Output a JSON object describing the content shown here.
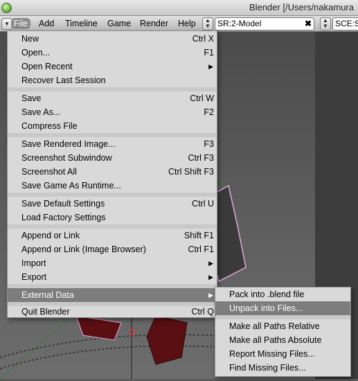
{
  "window": {
    "title": "Blender [/Users/nakamura"
  },
  "menubar": {
    "items": [
      "File",
      "Add",
      "Timeline",
      "Game",
      "Render",
      "Help"
    ],
    "screen_field": "SR:2-Model",
    "screen_close": "✖",
    "scene_field": "SCE:S"
  },
  "file_menu": {
    "items": [
      {
        "label": "New",
        "shortcut": "Ctrl X"
      },
      {
        "label": "Open...",
        "shortcut": "F1"
      },
      {
        "label": "Open Recent",
        "arrow": "▶"
      },
      {
        "label": "Recover Last Session",
        "shortcut": ""
      },
      {
        "label": "Save",
        "shortcut": "Ctrl W"
      },
      {
        "label": "Save As...",
        "shortcut": "F2"
      },
      {
        "label": "Compress File",
        "shortcut": ""
      },
      {
        "label": "Save Rendered Image...",
        "shortcut": "F3"
      },
      {
        "label": "Screenshot Subwindow",
        "shortcut": "Ctrl F3"
      },
      {
        "label": "Screenshot All",
        "shortcut": "Ctrl Shift F3"
      },
      {
        "label": "Save Game As Runtime...",
        "shortcut": ""
      },
      {
        "label": "Save Default Settings",
        "shortcut": "Ctrl U"
      },
      {
        "label": "Load Factory Settings",
        "shortcut": ""
      },
      {
        "label": "Append or Link",
        "shortcut": "Shift F1"
      },
      {
        "label": "Append or Link (Image Browser)",
        "shortcut": "Ctrl F1"
      },
      {
        "label": "Import",
        "arrow": "▶"
      },
      {
        "label": "Export",
        "arrow": "▶"
      },
      {
        "label": "External Data",
        "arrow": "▶"
      },
      {
        "label": "Quit Blender",
        "shortcut": "Ctrl Q"
      }
    ]
  },
  "external_data_menu": {
    "items": [
      {
        "label": "Pack into .blend file"
      },
      {
        "label": "Unpack into Files..."
      },
      {
        "label": "Make all Paths Relative"
      },
      {
        "label": "Make all Paths Absolute"
      },
      {
        "label": "Report Missing Files..."
      },
      {
        "label": "Find Missing Files..."
      }
    ]
  },
  "colors": {
    "highlight": "#7d7d7d",
    "menu_bg": "#d9d9d9",
    "object_red": "#5a0f12",
    "selection_outline": "#e6a8e0"
  }
}
